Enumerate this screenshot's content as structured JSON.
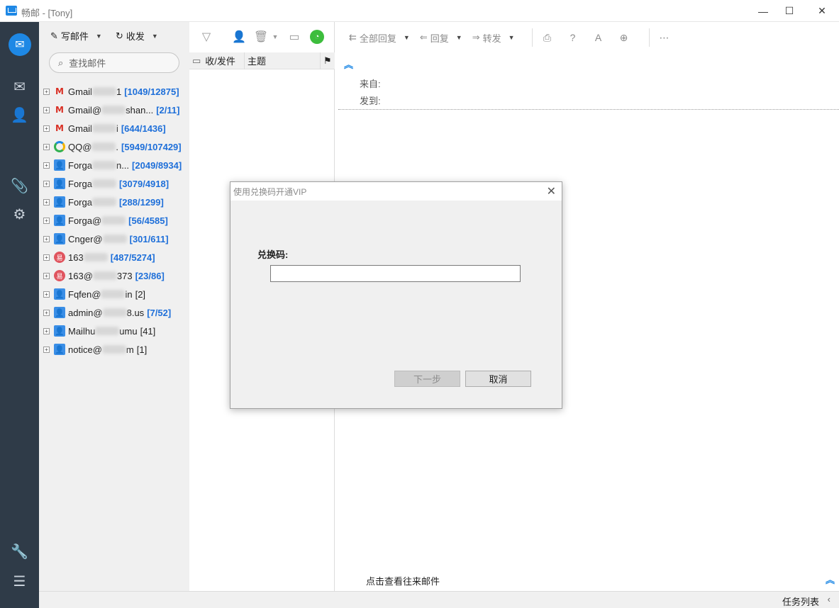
{
  "window": {
    "title": "畅邮 - [Tony]",
    "controls": {
      "minimize": "—",
      "maximize": "☐",
      "close": "✕"
    }
  },
  "rail": {
    "icons": [
      "mail-app-icon",
      "inbox-icon",
      "contacts-icon",
      "attachment-icon",
      "settings-icon",
      "tools-icon",
      "menu-icon"
    ]
  },
  "accounts_toolbar": {
    "compose": "写邮件",
    "receive": "收发"
  },
  "search": {
    "placeholder": "查找邮件"
  },
  "accounts": [
    {
      "name": "Gmail",
      "tail": "1",
      "count": "[1049/12875]",
      "type": "gmail"
    },
    {
      "name": "Gmail@",
      "tail": "shan...",
      "count": "[2/11]",
      "type": "gmail"
    },
    {
      "name": "Gmail",
      "tail": "i",
      "count": "[644/1436]",
      "type": "gmail"
    },
    {
      "name": "QQ@",
      "tail": ".",
      "count": "[5949/107429]",
      "type": "qq"
    },
    {
      "name": "Forga",
      "tail": "n...",
      "count": "[2049/8934]",
      "type": "user"
    },
    {
      "name": "Forga",
      "tail": "",
      "count": "[3079/4918]",
      "type": "user"
    },
    {
      "name": "Forga",
      "tail": "",
      "count": "[288/1299]",
      "type": "user"
    },
    {
      "name": "Forga@",
      "tail": "",
      "count": "[56/4585]",
      "type": "user"
    },
    {
      "name": "Cnger@",
      "tail": "",
      "count": "[301/611]",
      "type": "user"
    },
    {
      "name": "163",
      "tail": "",
      "count": "[487/5274]",
      "type": "n163"
    },
    {
      "name": "163@",
      "tail": "373",
      "count": "[23/86]",
      "type": "n163"
    },
    {
      "name": "Fqfen@",
      "tail": "in",
      "count": "[2]",
      "type": "user",
      "plain": true
    },
    {
      "name": "admin@",
      "tail": "8.us",
      "count": "[7/52]",
      "type": "user"
    },
    {
      "name": "Mailhu",
      "tail": "umu",
      "count": "[41]",
      "type": "user",
      "plain": true
    },
    {
      "name": "notice@",
      "tail": "m",
      "count": "[1]",
      "type": "user",
      "plain": true
    }
  ],
  "message_list": {
    "col_sender": "收/发件",
    "col_subject": "主题"
  },
  "reader": {
    "reply_all": "全部回复",
    "reply": "回复",
    "forward": "转发",
    "from_label": "来自:",
    "to_label": "发到:",
    "history_link": "点击查看往来邮件"
  },
  "statusbar": {
    "tasks": "任务列表"
  },
  "dialog": {
    "title": "使用兑换码开通VIP",
    "code_label": "兑换码:",
    "code_value": "",
    "next_button": "下一步",
    "cancel_button": "取消"
  },
  "colors": {
    "rail_bg": "#2f3b48",
    "accent": "#1e88e5",
    "count_blue": "#1e6fd9"
  }
}
